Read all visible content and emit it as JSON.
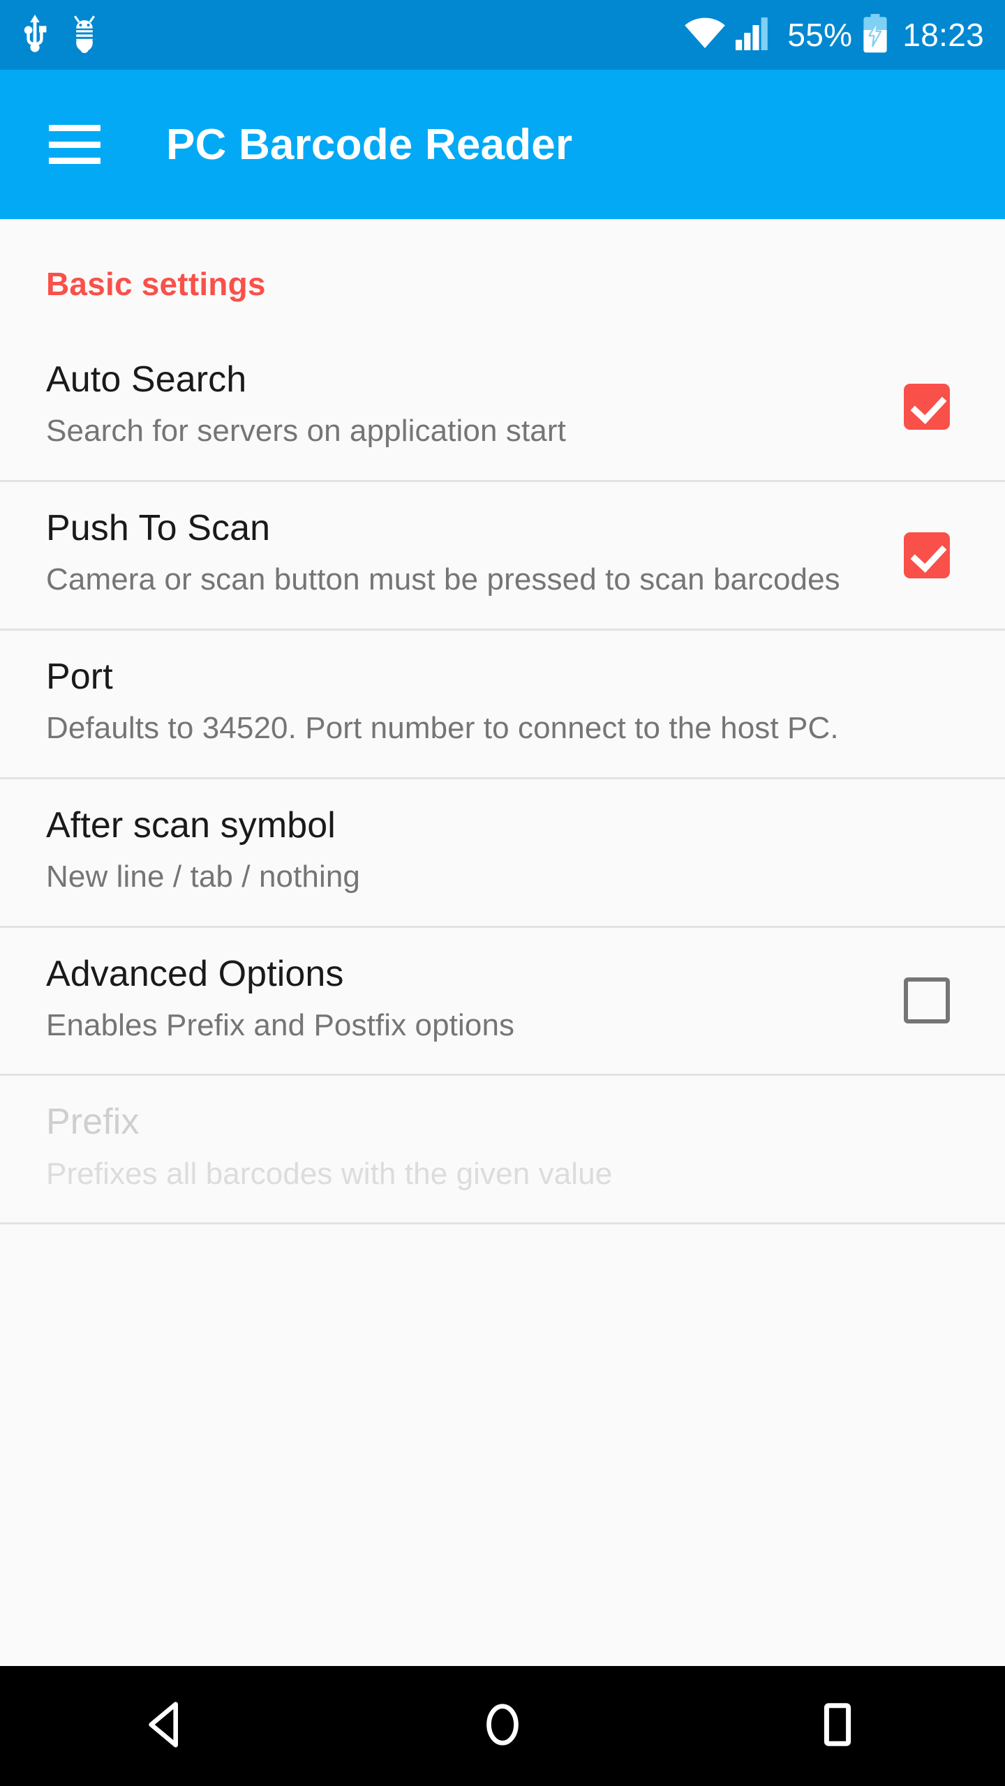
{
  "status_bar": {
    "icons": [
      "usb-icon",
      "android-debug-bug-icon",
      "wifi-icon",
      "cellular-signal-icon",
      "battery-charging-icon"
    ],
    "battery_percent": "55%",
    "clock": "18:23",
    "background_color": "#0288D1"
  },
  "app_bar": {
    "menu_icon": "hamburger-menu-icon",
    "title": "PC Barcode Reader",
    "background_color": "#03A9F4"
  },
  "content": {
    "section_header": "Basic settings",
    "accent_color": "#F9504A",
    "preferences": [
      {
        "title": "Auto Search",
        "summary": "Search for servers on application start",
        "widget": "checkbox",
        "checked": true,
        "enabled": true
      },
      {
        "title": "Push To Scan",
        "summary": "Camera or scan button must be pressed to scan barcodes",
        "widget": "checkbox",
        "checked": true,
        "enabled": true
      },
      {
        "title": "Port",
        "summary": "Defaults to 34520. Port number to connect to the host PC.",
        "widget": "none",
        "checked": false,
        "enabled": true
      },
      {
        "title": "After scan symbol",
        "summary": "New line / tab / nothing",
        "widget": "none",
        "checked": false,
        "enabled": true
      },
      {
        "title": "Advanced Options",
        "summary": "Enables Prefix and Postfix options",
        "widget": "checkbox",
        "checked": false,
        "enabled": true
      },
      {
        "title": "Prefix",
        "summary": "Prefixes all barcodes with the given value",
        "widget": "none",
        "checked": false,
        "enabled": false
      }
    ]
  },
  "nav_bar": {
    "buttons": [
      {
        "name": "back-button",
        "icon": "back-triangle-icon"
      },
      {
        "name": "home-button",
        "icon": "home-circle-icon"
      },
      {
        "name": "recents-button",
        "icon": "recents-square-icon"
      }
    ],
    "background_color": "#000000"
  }
}
